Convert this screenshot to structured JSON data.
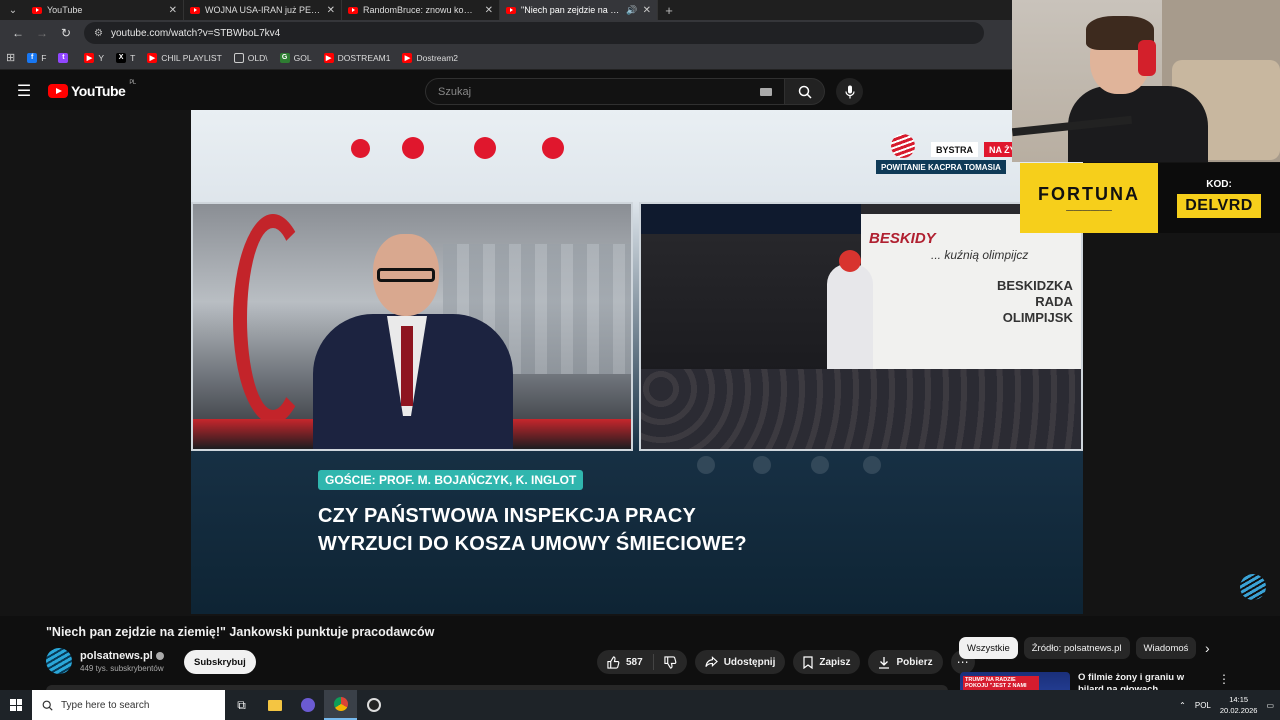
{
  "browser": {
    "tabs": [
      {
        "title": "YouTube",
        "active": false,
        "audio": false
      },
      {
        "title": "WOJNA USA-IRAN już PEWNA",
        "active": false,
        "audio": false
      },
      {
        "title": "RandomBruce: znowu komp do",
        "active": false,
        "audio": false
      },
      {
        "title": "\"Niech pan zejdzie na ziemi",
        "active": true,
        "audio": true
      }
    ],
    "url": "youtube.com/watch?v=STBWboL7kv4",
    "bookmarks": [
      {
        "label": "F",
        "icon": "facebook-icon",
        "color": "#1877f2"
      },
      {
        "label": "",
        "icon": "twitch-icon",
        "color": "#9146ff"
      },
      {
        "label": "Y",
        "icon": "youtube-icon",
        "color": "#ff0000"
      },
      {
        "label": "T",
        "icon": "x-icon",
        "color": "#000000"
      },
      {
        "label": "CHIL PLAYLIST",
        "icon": "youtube-icon",
        "color": "#ff0000"
      },
      {
        "label": "OLD\\",
        "icon": "folder-icon",
        "color": "#35363a"
      },
      {
        "label": "GOL",
        "icon": "gol-icon",
        "color": "#2e7d32"
      },
      {
        "label": "DOSTREAM1",
        "icon": "youtube-icon",
        "color": "#ff0000"
      },
      {
        "label": "Dostream2",
        "icon": "youtube-icon",
        "color": "#ff0000"
      }
    ]
  },
  "youtube": {
    "logo_text": "YouTube",
    "logo_region": "PL",
    "search_placeholder": "Szukaj"
  },
  "video_frame": {
    "channel_badge": "BYSTRA",
    "live_badge": "NA ŻYWO",
    "live_subtitle": "POWITANIE KACPRA TOMASIA",
    "guests": "GOŚCIE: PROF. M. BOJAŃCZYK, K. INGLOT",
    "headline_line1": "CZY PAŃSTWOWA INSPEKCJA PRACY",
    "headline_line2": "WYRZUCI DO KOSZA UMOWY ŚMIECIOWE?",
    "banner_title": "BESKIDY",
    "banner_sub": "... kuźnią olimpijcz",
    "banner_rada1": "BESKIDZKA",
    "banner_rada2": "RADA",
    "banner_rada3": "OLIMPIJSK"
  },
  "overlay": {
    "sponsor": "FORTUNA",
    "code_label": "KOD:",
    "code_value": "DELVRD"
  },
  "video": {
    "title": "\"Niech pan zejdzie na ziemię!\" Jankowski punktuje pracodawców",
    "channel": "polsatnews.pl",
    "subscribers": "449 tys. subskrybentów",
    "subscribe_label": "Subskrybuj",
    "likes": "587",
    "share_label": "Udostępnij",
    "save_label": "Zapisz",
    "download_label": "Pobierz"
  },
  "chips": [
    "Wszystkie",
    "Źródło: polsatnews.pl",
    "Wiadomoś"
  ],
  "recommendation": {
    "thumb_tag": "TRUMP NA RADZIE POKOJU \"JEST Z NAMI",
    "title": "O filmie żony i graniu w bilard na głowach. Najdziwniejsze"
  },
  "taskbar": {
    "search_placeholder": "Type here to search",
    "lang": "POL",
    "time": "14:15",
    "date": "20.02.2026"
  }
}
